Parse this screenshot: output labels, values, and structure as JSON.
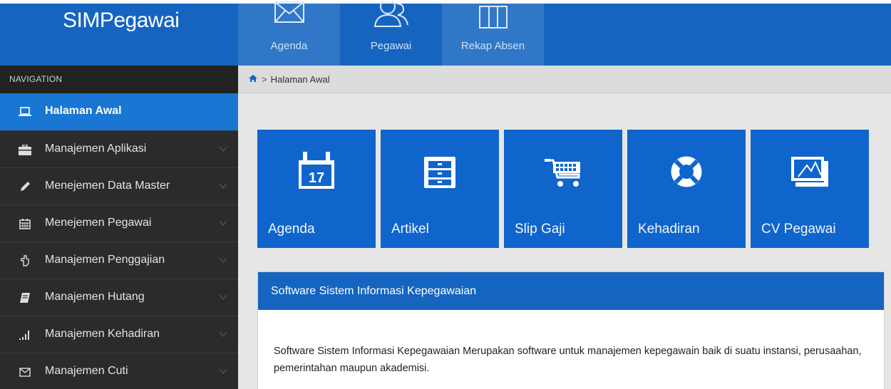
{
  "brand": {
    "title_strong": "SIM",
    "title_rest": "Pegawai"
  },
  "topnav": [
    {
      "label": "Agenda",
      "icon": "envelope-icon"
    },
    {
      "label": "Pegawai",
      "icon": "users-icon"
    },
    {
      "label": "Rekap Absen",
      "icon": "columns-icon"
    }
  ],
  "sidebar": {
    "header": "NAVIGATION",
    "items": [
      {
        "label": "Halaman Awal",
        "icon": "laptop-icon",
        "active": true
      },
      {
        "label": "Manajemen Aplikasi",
        "icon": "briefcase-icon"
      },
      {
        "label": "Menejemen Data Master",
        "icon": "pencil-icon"
      },
      {
        "label": "Menejemen Pegawai",
        "icon": "calendar-icon"
      },
      {
        "label": "Manajemen Penggajian",
        "icon": "hand-pointer-icon"
      },
      {
        "label": "Manajemen Hutang",
        "icon": "book-icon"
      },
      {
        "label": "Manajemen Kehadiran",
        "icon": "signal-icon"
      },
      {
        "label": "Manajemen Cuti",
        "icon": "envelope-icon"
      }
    ]
  },
  "breadcrumb": {
    "home_icon": "home-icon",
    "current": "Halaman Awal"
  },
  "tiles": [
    {
      "label": "Agenda",
      "icon": "calendar-icon",
      "day": "17"
    },
    {
      "label": "Artikel",
      "icon": "cabinet-icon"
    },
    {
      "label": "Slip Gaji",
      "icon": "cart-icon"
    },
    {
      "label": "Kehadiran",
      "icon": "lifebuoy-icon"
    },
    {
      "label": "CV Pegawai",
      "icon": "picture-icon"
    }
  ],
  "panel": {
    "title": "Software Sistem Informasi Kepegawaian",
    "body": "Software Sistem Informasi Kepegawaian Merupakan software untuk manajemen kepegawain baik di suatu instansi, perusaahan, pemerintahan maupun akademisi."
  },
  "colors": {
    "primary": "#1565c0",
    "tile": "#0f65cc",
    "sidebar": "#2b2b2b",
    "active": "#1976d2"
  }
}
